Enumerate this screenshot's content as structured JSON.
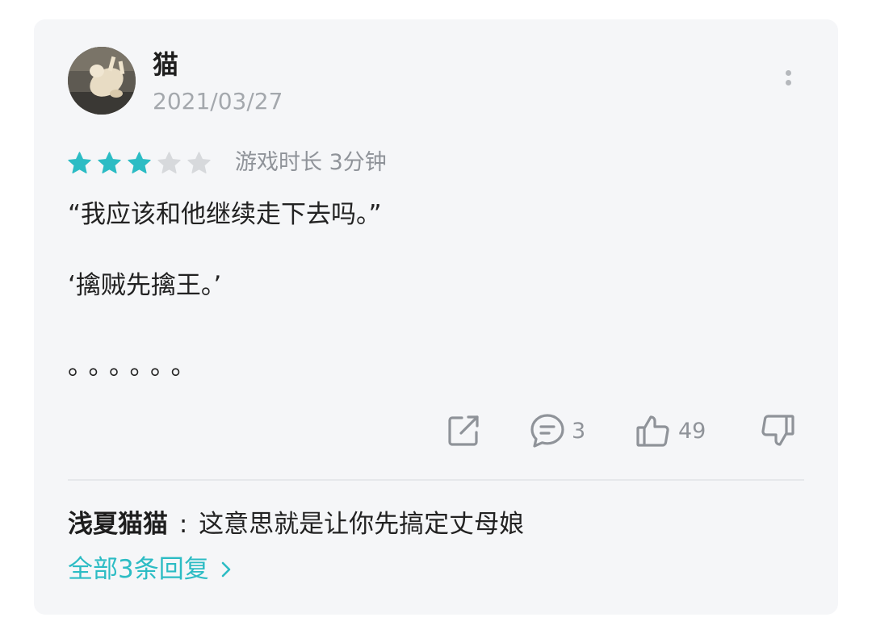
{
  "review": {
    "username": "猫",
    "date": "2021/03/27",
    "rating": 3,
    "rating_max": 5,
    "playtime": "游戏时长 3分钟",
    "content": [
      "“我应该和他继续走下去吗。”",
      "‘擒贼先擒王。’",
      "。。。。。。"
    ]
  },
  "actions": {
    "share_icon": "share-icon",
    "comment_icon": "comment-icon",
    "comment_count": "3",
    "like_icon": "thumbs-up-icon",
    "like_count": "49",
    "dislike_icon": "thumbs-down-icon"
  },
  "reply": {
    "author": "浅夏猫猫",
    "separator": ":",
    "text": "这意思就是让你先搞定丈母娘"
  },
  "all_replies_label": "全部3条回复",
  "colors": {
    "accent": "#2cbcc4",
    "star_on": "#2cbcc4",
    "star_off": "#d7d9dc",
    "muted_text": "#8f9399",
    "card_bg": "#f5f6f8"
  }
}
